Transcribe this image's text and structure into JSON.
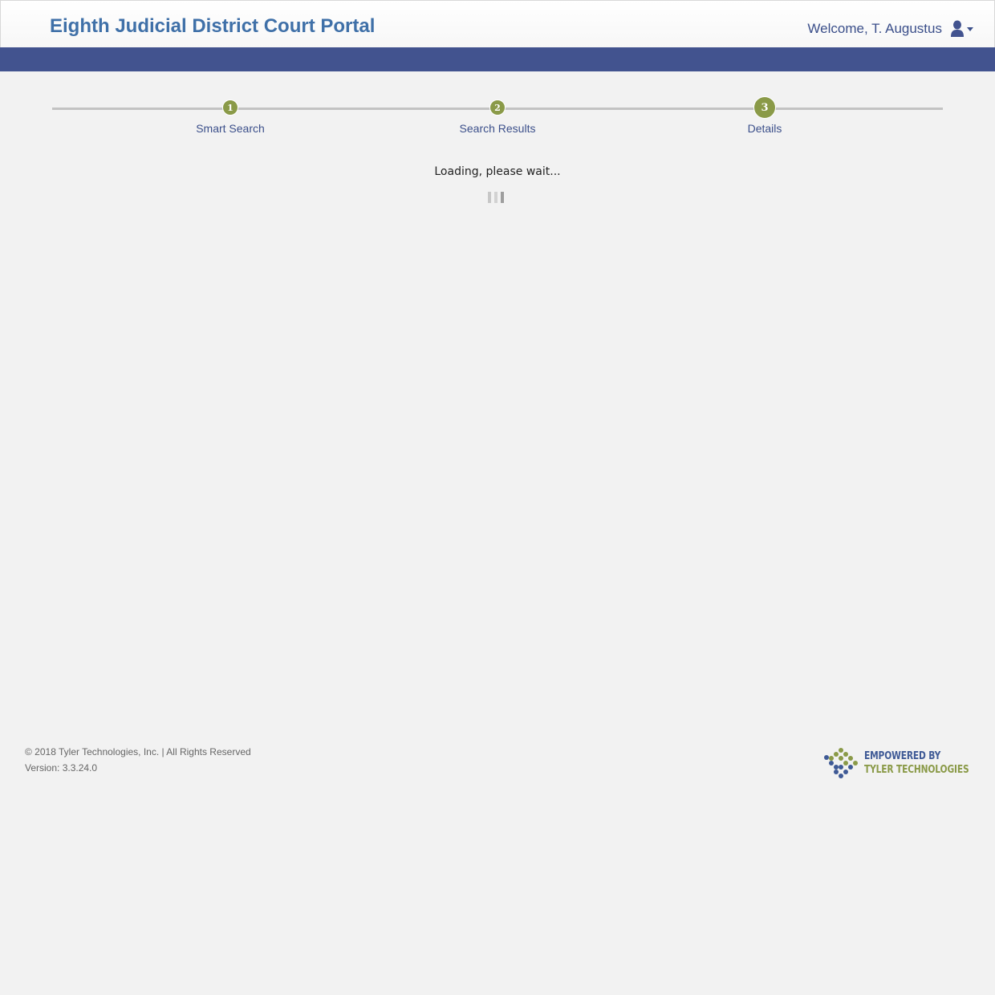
{
  "header": {
    "title": "Eighth Judicial District Court Portal",
    "welcome": "Welcome, T. Augustus",
    "user_icon": "user-icon",
    "caret_icon": "caret-down-icon"
  },
  "colors": {
    "title": "#3f70a8",
    "nav_bar": "#42538f",
    "step_dot": "#8a9a48",
    "link": "#3b4f8a",
    "background": "#f2f2f2"
  },
  "steps": [
    {
      "number": "1",
      "label": "Smart Search"
    },
    {
      "number": "2",
      "label": "Search Results"
    },
    {
      "number": "3",
      "label": "Details"
    }
  ],
  "loading": {
    "text": "Loading, please wait..."
  },
  "footer": {
    "copyright": "© 2018 Tyler Technologies, Inc. | All Rights Reserved",
    "version": "Version: 3.3.24.0",
    "logo_line1": "EMPOWERED BY",
    "logo_line2": "TYLER TECHNOLOGIES"
  }
}
